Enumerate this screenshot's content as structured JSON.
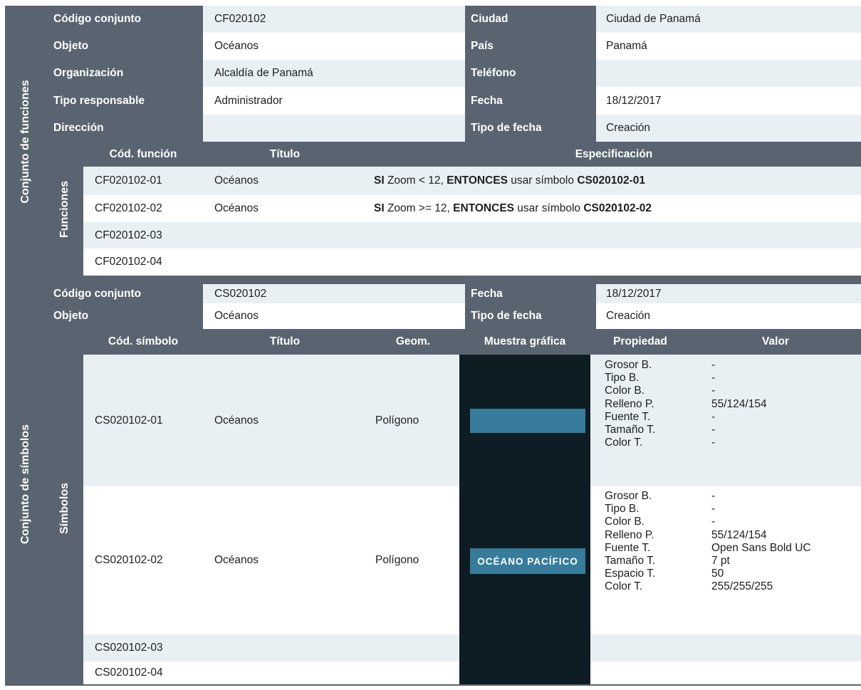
{
  "funciones": {
    "group_label": "Conjunto de funciones",
    "sub_label": "Funciones",
    "info": [
      {
        "label": "Código conjunto",
        "value": "CF020102",
        "label2": "Ciudad",
        "value2": "Ciudad de Panamá"
      },
      {
        "label": "Objeto",
        "value": "Océanos",
        "label2": "País",
        "value2": "Panamá"
      },
      {
        "label": "Organización",
        "value": "Alcaldía de Panamá",
        "label2": "Teléfono",
        "value2": ""
      },
      {
        "label": "Tipo responsable",
        "value": "Administrador",
        "label2": "Fecha",
        "value2": "18/12/2017"
      },
      {
        "label": "Dirección",
        "value": "",
        "label2": "Tipo de fecha",
        "value2": "Creación"
      }
    ],
    "columns": {
      "code": "Cód. función",
      "title": "Título",
      "spec": "Especificación"
    },
    "rows": [
      {
        "code": "CF020102-01",
        "title": "Océanos",
        "spec": {
          "kw1": "SI",
          "t1": " Zoom < 12, ",
          "kw2": "ENTONCES",
          "t2": " usar símbolo ",
          "kw3": "CS020102-01"
        }
      },
      {
        "code": "CF020102-02",
        "title": "Océanos",
        "spec": {
          "kw1": "SI",
          "t1": " Zoom >= 12, ",
          "kw2": "ENTONCES",
          "t2": " usar símbolo ",
          "kw3": "CS020102-02"
        }
      },
      {
        "code": "CF020102-03",
        "title": ""
      },
      {
        "code": "CF020102-04",
        "title": ""
      }
    ]
  },
  "simbolos": {
    "group_label": "Conjunto de símbolos",
    "sub_label": "Símbolos",
    "info": [
      {
        "label": "Código conjunto",
        "value": "CS020102",
        "label2": "Fecha",
        "value2": "18/12/2017"
      },
      {
        "label": "Objeto",
        "value": "Océanos",
        "label2": "Tipo de fecha",
        "value2": "Creación"
      }
    ],
    "columns": {
      "code": "Cód. símbolo",
      "title": "Título",
      "geom": "Geom.",
      "sample": "Muestra gráfica",
      "prop": "Propiedad",
      "value": "Valor"
    },
    "rows": [
      {
        "code": "CS020102-01",
        "title": "Océanos",
        "geom": "Polígono",
        "props": [
          "Grosor B.",
          "Tipo B.",
          "Color B.",
          "Relleno P.",
          "Fuente T.",
          "Tamaño T.",
          "Color T."
        ],
        "values": [
          "-",
          "-",
          "-",
          "55/124/154",
          "-",
          "-",
          "-"
        ]
      },
      {
        "code": "CS020102-02",
        "title": "Océanos",
        "geom": "Polígono",
        "sample_text": "OCÉANO PACÍFICO",
        "props": [
          "Grosor B.",
          "Tipo B.",
          "Color B.",
          "Relleno P.",
          "Fuente T.",
          "Tamaño T.",
          "Espacio T.",
          "Color T."
        ],
        "values": [
          "-",
          "-",
          "-",
          "55/124/154",
          "Open Sans Bold UC",
          "7 pt",
          "50",
          "255/255/255"
        ]
      },
      {
        "code": "CS020102-03"
      },
      {
        "code": "CS020102-04"
      }
    ]
  },
  "colors": {
    "header": "#5a6470",
    "row_light": "#e9f0f4",
    "sample_bg": "#0e1d24",
    "fill": "#377c9a"
  }
}
